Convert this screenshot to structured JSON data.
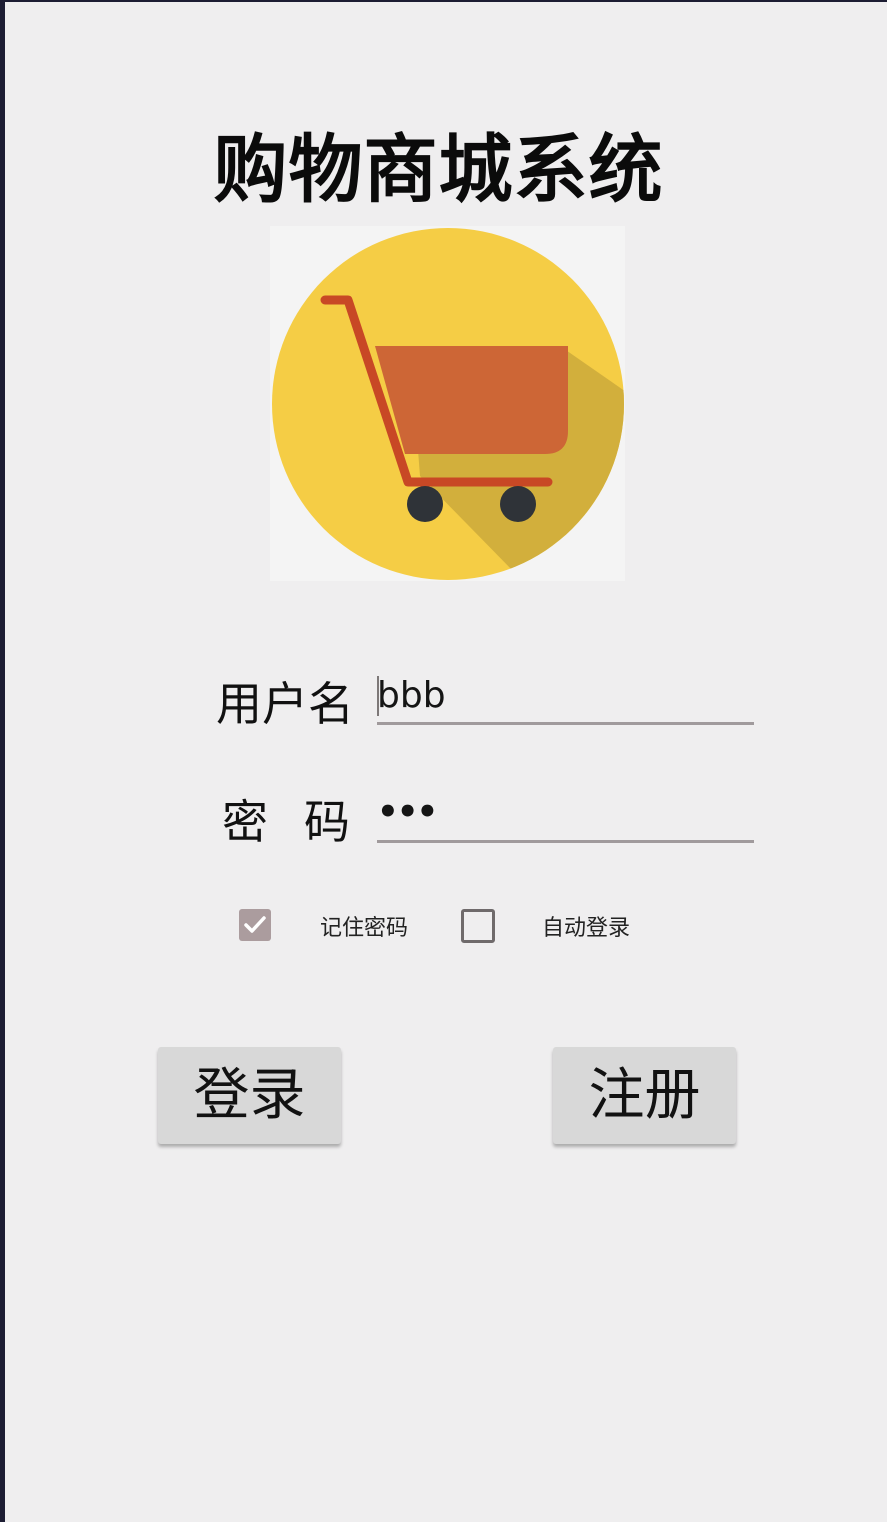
{
  "app": {
    "title": "购物商城系统",
    "logo_icon": "shopping-cart-icon"
  },
  "form": {
    "username_label": "用户名",
    "username_value": "bbb",
    "password_label": "密码",
    "password_value": "•••",
    "remember_password": {
      "label": "记住密码",
      "checked": true
    },
    "auto_login": {
      "label": "自动登录",
      "checked": false
    }
  },
  "buttons": {
    "login_label": "登录",
    "register_label": "注册"
  },
  "colors": {
    "background": "#efeeef",
    "logo_circle": "#f5cd45",
    "cart_body": "#cd6636",
    "cart_frame": "#c84825",
    "wheels": "#2f3338",
    "checkbox_checked": "#ab9c9e"
  }
}
